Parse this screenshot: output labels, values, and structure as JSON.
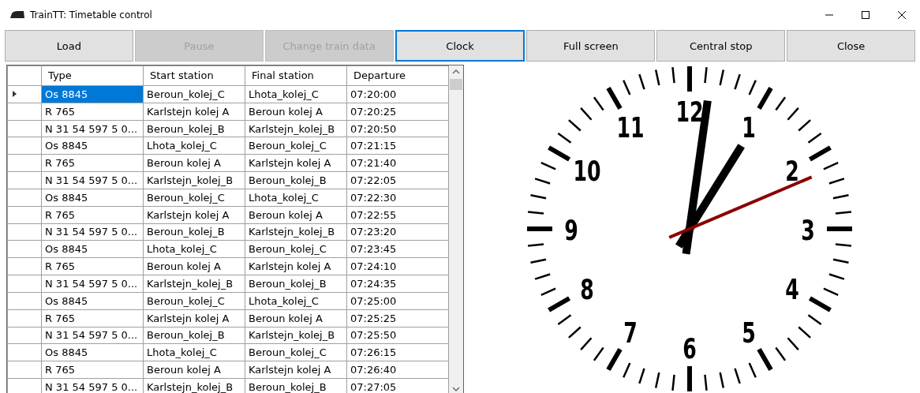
{
  "window": {
    "title": "TrainTT: Timetable control"
  },
  "buttons": [
    {
      "label": "Load",
      "disabled": false,
      "focused": false
    },
    {
      "label": "Pause",
      "disabled": true,
      "focused": false
    },
    {
      "label": "Change train data",
      "disabled": true,
      "focused": false
    },
    {
      "label": "Clock",
      "disabled": false,
      "focused": true
    },
    {
      "label": "Full screen",
      "disabled": false,
      "focused": false
    },
    {
      "label": "Central stop",
      "disabled": false,
      "focused": false
    },
    {
      "label": "Close",
      "disabled": false,
      "focused": false
    }
  ],
  "table": {
    "columns": [
      "Type",
      "Start station",
      "Final station",
      "Departure"
    ],
    "rows": [
      {
        "cells": [
          "Os 8845",
          "Beroun_kolej_C",
          "Lhota_kolej_C",
          "07:20:00"
        ],
        "selected": true
      },
      {
        "cells": [
          "R 765",
          "Karlstejn kolej A",
          "Beroun kolej A",
          "07:20:25"
        ],
        "selected": false
      },
      {
        "cells": [
          "N 31 54 597 5 0...",
          "Beroun_kolej_B",
          "Karlstejn_kolej_B",
          "07:20:50"
        ],
        "selected": false
      },
      {
        "cells": [
          "Os 8845",
          "Lhota_kolej_C",
          "Beroun_kolej_C",
          "07:21:15"
        ],
        "selected": false
      },
      {
        "cells": [
          "R 765",
          "Beroun kolej A",
          "Karlstejn kolej A",
          "07:21:40"
        ],
        "selected": false
      },
      {
        "cells": [
          "N 31 54 597 5 0...",
          "Karlstejn_kolej_B",
          "Beroun_kolej_B",
          "07:22:05"
        ],
        "selected": false
      },
      {
        "cells": [
          "Os 8845",
          "Beroun_kolej_C",
          "Lhota_kolej_C",
          "07:22:30"
        ],
        "selected": false
      },
      {
        "cells": [
          "R 765",
          "Karlstejn kolej A",
          "Beroun kolej A",
          "07:22:55"
        ],
        "selected": false
      },
      {
        "cells": [
          "N 31 54 597 5 0...",
          "Beroun_kolej_B",
          "Karlstejn_kolej_B",
          "07:23:20"
        ],
        "selected": false
      },
      {
        "cells": [
          "Os 8845",
          "Lhota_kolej_C",
          "Beroun_kolej_C",
          "07:23:45"
        ],
        "selected": false
      },
      {
        "cells": [
          "R 765",
          "Beroun kolej A",
          "Karlstejn kolej A",
          "07:24:10"
        ],
        "selected": false
      },
      {
        "cells": [
          "N 31 54 597 5 0...",
          "Karlstejn_kolej_B",
          "Beroun_kolej_B",
          "07:24:35"
        ],
        "selected": false
      },
      {
        "cells": [
          "Os 8845",
          "Beroun_kolej_C",
          "Lhota_kolej_C",
          "07:25:00"
        ],
        "selected": false
      },
      {
        "cells": [
          "R 765",
          "Karlstejn kolej A",
          "Beroun kolej A",
          "07:25:25"
        ],
        "selected": false
      },
      {
        "cells": [
          "N 31 54 597 5 0...",
          "Beroun_kolej_B",
          "Karlstejn_kolej_B",
          "07:25:50"
        ],
        "selected": false
      },
      {
        "cells": [
          "Os 8845",
          "Lhota_kolej_C",
          "Beroun_kolej_C",
          "07:26:15"
        ],
        "selected": false
      },
      {
        "cells": [
          "R 765",
          "Beroun kolej A",
          "Karlstejn kolej A",
          "07:26:40"
        ],
        "selected": false
      },
      {
        "cells": [
          "N 31 54 597 5 0...",
          "Karlstejn_kolej_B",
          "Beroun_kolej_B",
          "07:27:05"
        ],
        "selected": false
      }
    ]
  },
  "clock": {
    "numerals": [
      "12",
      "1",
      "2",
      "3",
      "4",
      "5",
      "6",
      "7",
      "8",
      "9",
      "10",
      "11"
    ]
  }
}
